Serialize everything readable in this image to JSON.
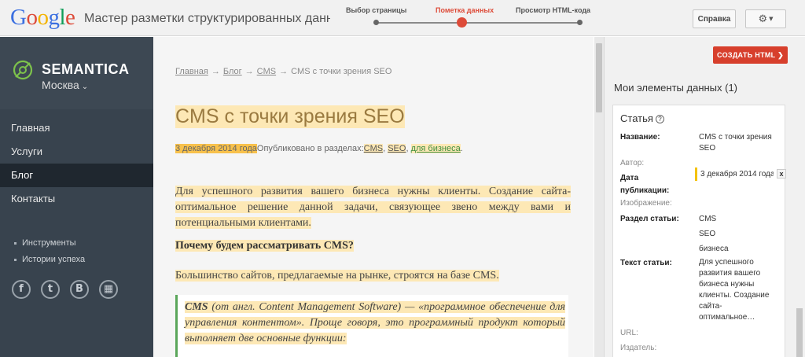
{
  "app": {
    "logo_letters": [
      {
        "ch": "G",
        "color": "#3b6fe0"
      },
      {
        "ch": "o",
        "color": "#dd4b39"
      },
      {
        "ch": "o",
        "color": "#f4b400"
      },
      {
        "ch": "g",
        "color": "#3b6fe0"
      },
      {
        "ch": "l",
        "color": "#0f9d58"
      },
      {
        "ch": "e",
        "color": "#dd4b39"
      }
    ],
    "title": "Мастер разметки структурированных данных",
    "steps": [
      {
        "label": "Выбор страницы",
        "active": false
      },
      {
        "label": "Пометка данных",
        "active": true
      },
      {
        "label": "Просмотр HTML-кода",
        "active": false
      }
    ],
    "help_label": "Справка",
    "settings_icon": "gear-icon",
    "accent_color": "#dd4b39"
  },
  "site": {
    "brand": "SEMANTICA",
    "city": "Москва",
    "nav": [
      {
        "label": "Главная",
        "active": false
      },
      {
        "label": "Услуги",
        "active": false
      },
      {
        "label": "Блог",
        "active": true
      },
      {
        "label": "Контакты",
        "active": false
      }
    ],
    "subnav": [
      "Инструменты",
      "Истории успеха"
    ],
    "socials": [
      {
        "icon": "facebook-icon",
        "glyph": "f"
      },
      {
        "icon": "twitter-icon",
        "glyph": "t"
      },
      {
        "icon": "vk-icon",
        "glyph": "B"
      },
      {
        "icon": "apps-icon",
        "glyph": "▦"
      }
    ]
  },
  "article": {
    "breadcrumbs": [
      "Главная",
      "Блог",
      "CMS",
      "CMS с точки зрения SEO"
    ],
    "breadcrumb_separator": "→",
    "title": "CMS с точки зрения SEO",
    "date": "3 декабря 2014 года",
    "published_in": "Опубликовано в разделах:",
    "tags": [
      "CMS",
      "SEO",
      "для бизнеса"
    ],
    "tag_separator": ",",
    "meta_end": ".",
    "paragraph1": "Для успешного развития вашего бизнеса нужны клиенты. Создание сайта-оптимальное решение данной задачи, связующее звено между вами и потенциальными клиентами.",
    "heading": "Почему будем рассматривать CMS?",
    "paragraph2": "Большинство сайтов, предлагаемые на рынке, строятся на базе CMS.",
    "quote_term": "CMS",
    "quote_rest": " (от англ. Content Management Software) — «программное обеспечение для управления контентом». Проще говоря, это программный продукт который выполняет две основные функции:"
  },
  "panel": {
    "create_label": "СОЗДАТЬ HTML",
    "title": "Мои элементы данных (1)",
    "card_title": "Статья",
    "fields": {
      "name_label": "Название:",
      "name_value": "CMS с точки зрения SEO",
      "author_label": "Автор:",
      "date_label": "Дата публикации:",
      "date_value": "3 декабря 2014 года",
      "remove_label": "x",
      "image_label": "Изображение:",
      "section_label": "Раздел статьи:",
      "section_values": [
        "CMS",
        "SEO",
        "бизнеса"
      ],
      "text_label": "Текст статьи:",
      "text_value": "Для успешного развития вашего бизнеса нужны клиенты. Создание сайта-оптимальное…",
      "url_label": "URL:",
      "publisher_label": "Издатель:"
    }
  }
}
